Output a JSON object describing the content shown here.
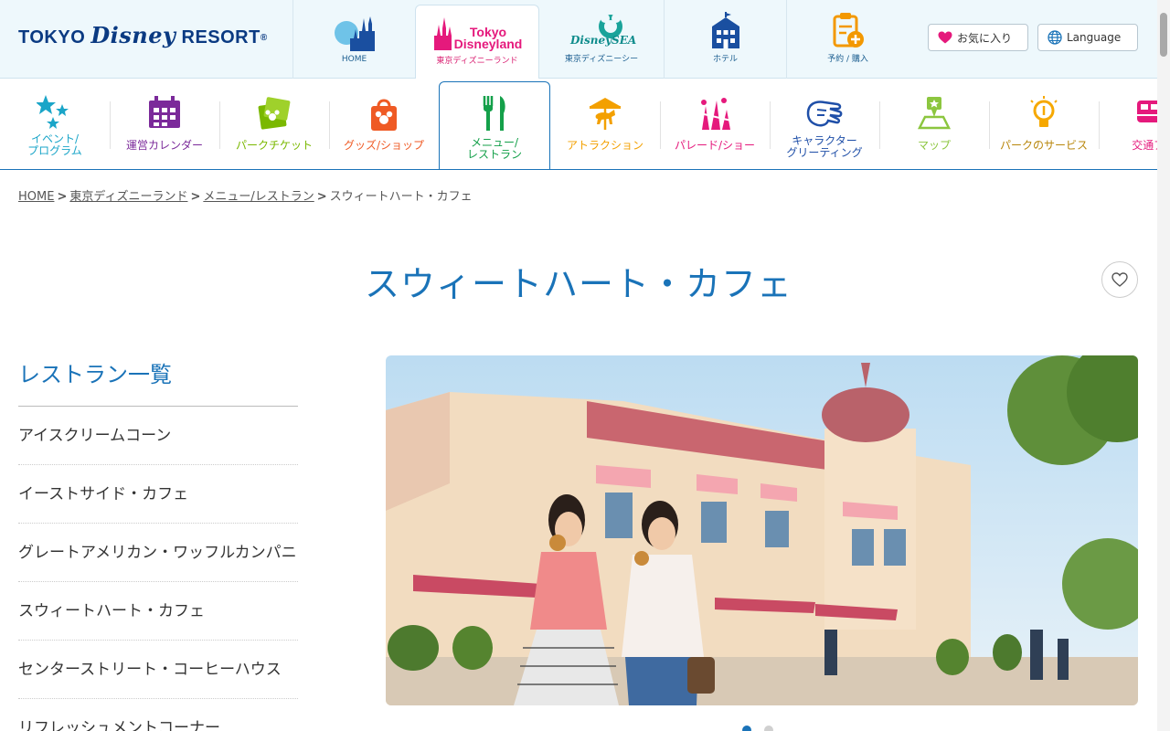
{
  "header": {
    "logo_text_1": "TOKYO",
    "logo_text_2": "Disney",
    "logo_text_3": "RESORT",
    "logo_reg": "®",
    "tabs": [
      {
        "label": "HOME"
      },
      {
        "label": "東京ディズニーランド",
        "brand_1": "Tokyo",
        "brand_2": "Disneyland"
      },
      {
        "label": "東京ディズニーシー",
        "brand": "DisneySEA"
      },
      {
        "label": "ホテル"
      },
      {
        "label": "予約 / 購入"
      }
    ],
    "favorite_button": "お気に入り",
    "language_button": "Language"
  },
  "category_nav": [
    {
      "label_1": "イベント/",
      "label_2": "プログラム",
      "color": "#1aa5c8"
    },
    {
      "label_1": "運営カレンダー",
      "color": "#7b2a9a"
    },
    {
      "label_1": "パークチケット",
      "color": "#7ab800"
    },
    {
      "label_1": "グッズ/ショップ",
      "color": "#ef5a24"
    },
    {
      "label_1": "メニュー/",
      "label_2": "レストラン",
      "color": "#14a04a"
    },
    {
      "label_1": "アトラクション",
      "color": "#f3a000"
    },
    {
      "label_1": "パレード/ショー",
      "color": "#e5197c"
    },
    {
      "label_1": "キャラクター",
      "label_2": "グリーティング",
      "color": "#1f4fa8"
    },
    {
      "label_1": "マップ",
      "color": "#8cc63f"
    },
    {
      "label_1": "パークのサービス",
      "color": "#f6a800"
    },
    {
      "label_1": "交通アク",
      "color": "#e5197c"
    }
  ],
  "breadcrumb": [
    "HOME",
    "東京ディズニーランド",
    "メニュー/レストラン",
    "スウィートハート・カフェ"
  ],
  "breadcrumb_sep": ">",
  "page_title": "スウィートハート・カフェ",
  "sidebar": {
    "title": "レストラン一覧",
    "items": [
      "アイスクリームコーン",
      "イーストサイド・カフェ",
      "グレートアメリカン・ワッフルカンパニー",
      "スウィートハート・カフェ",
      "センターストリート・コーヒーハウス",
      "リフレッシュメントコーナー"
    ]
  },
  "carousel": {
    "slide_count": 2,
    "active_slide": 1
  },
  "colors": {
    "accent": "#1a73b8",
    "header_bg": "#eef8fc",
    "heart": "#e5197c"
  }
}
